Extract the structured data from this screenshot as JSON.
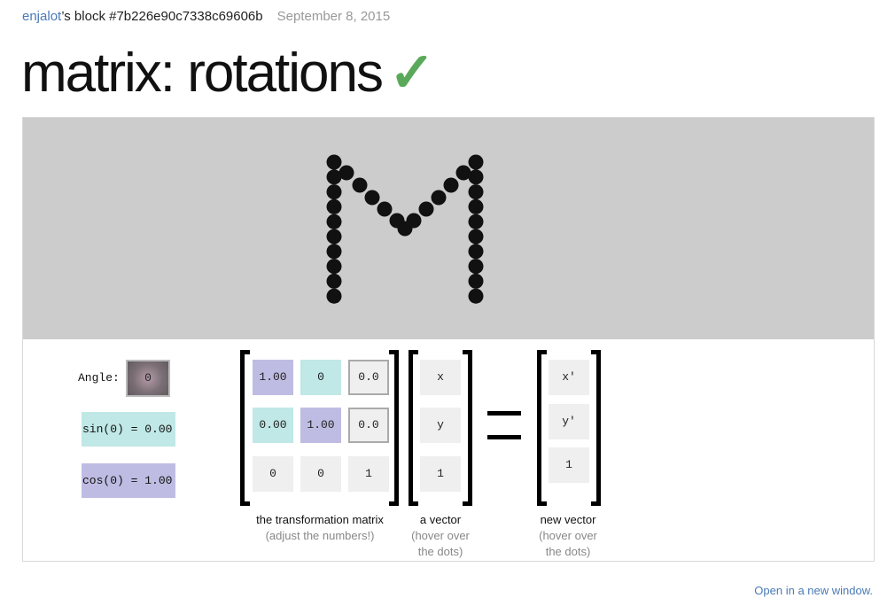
{
  "header": {
    "user": "enjalot",
    "block_text": "’s block #7b226e90c7338c69606b",
    "date": "September 8, 2015"
  },
  "title": "matrix: rotations",
  "title_check": "✓",
  "controls": {
    "angle_label": "Angle:",
    "angle_value": "0",
    "sin_text": "sin(0) = 0.00",
    "cos_text": "cos(0) = 1.00"
  },
  "matrix": {
    "rows": [
      [
        "1.00",
        "0",
        "0.0"
      ],
      [
        "0.00",
        "1.00",
        "0.0"
      ],
      [
        "0",
        "0",
        "1"
      ]
    ],
    "caption": "the transformation matrix",
    "caption_sub": "(adjust the numbers!)"
  },
  "vector": {
    "values": [
      "x",
      "y",
      "1"
    ],
    "caption": "a vector",
    "caption_sub_1": "(hover over",
    "caption_sub_2": "the dots)"
  },
  "new_vector": {
    "values": [
      "x'",
      "y'",
      "1"
    ],
    "caption": "new vector",
    "caption_sub_1": "(hover over",
    "caption_sub_2": "the dots)"
  },
  "footer": {
    "open_link": "Open in a new window."
  },
  "colors": {
    "link": "#4a7ab5",
    "check": "#5aa95a",
    "canvas_bg": "#cccccc",
    "sin_teal": "#bfe8e6",
    "cos_purple": "#bfbce3"
  },
  "icons": {
    "check": "checkmark-icon"
  }
}
